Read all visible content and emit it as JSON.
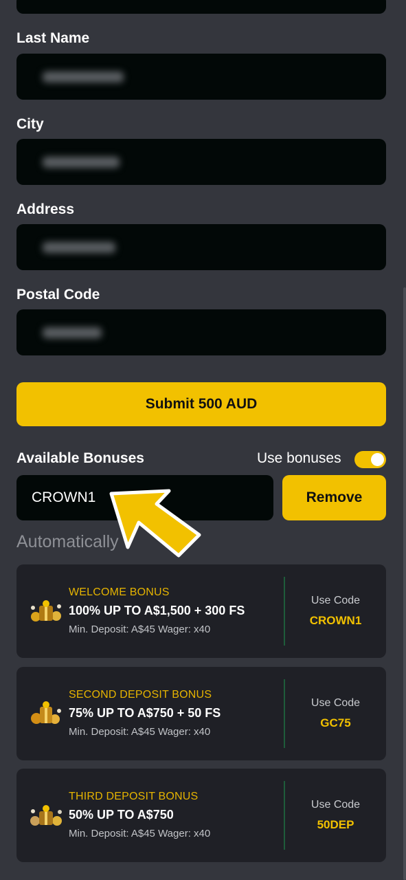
{
  "form": {
    "last_name_label": "Last Name",
    "city_label": "City",
    "address_label": "Address",
    "postal_code_label": "Postal Code"
  },
  "submit": {
    "label": "Submit 500 AUD"
  },
  "bonuses": {
    "title": "Available Bonuses",
    "toggle_label": "Use bonuses",
    "toggle_on": true,
    "code_value": "CROWN1",
    "remove_label": "Remove",
    "auto_label": "Automatically"
  },
  "cards": [
    {
      "name": "WELCOME BONUS",
      "headline": "100% UP TO A$1,500 + 300 FS",
      "minimum": "Min. Deposit: A$45 Wager: x40",
      "use_label": "Use Code",
      "code": "CROWN1",
      "icon": "gift-coins-icon"
    },
    {
      "name": "SECOND DEPOSIT BONUS",
      "headline": "75% UP TO A$750 + 50 FS",
      "minimum": "Min. Deposit: A$45 Wager: x40",
      "use_label": "Use Code",
      "code": "GC75",
      "icon": "gift-coins-icon"
    },
    {
      "name": "THIRD DEPOSIT BONUS",
      "headline": "50% UP TO A$750",
      "minimum": "Min. Deposit: A$45 Wager: x40",
      "use_label": "Use Code",
      "code": "50DEP",
      "icon": "gift-coins-icon"
    }
  ],
  "colors": {
    "accent": "#f2c100",
    "background": "#34363d",
    "field": "#020807",
    "card": "#1f2026"
  }
}
